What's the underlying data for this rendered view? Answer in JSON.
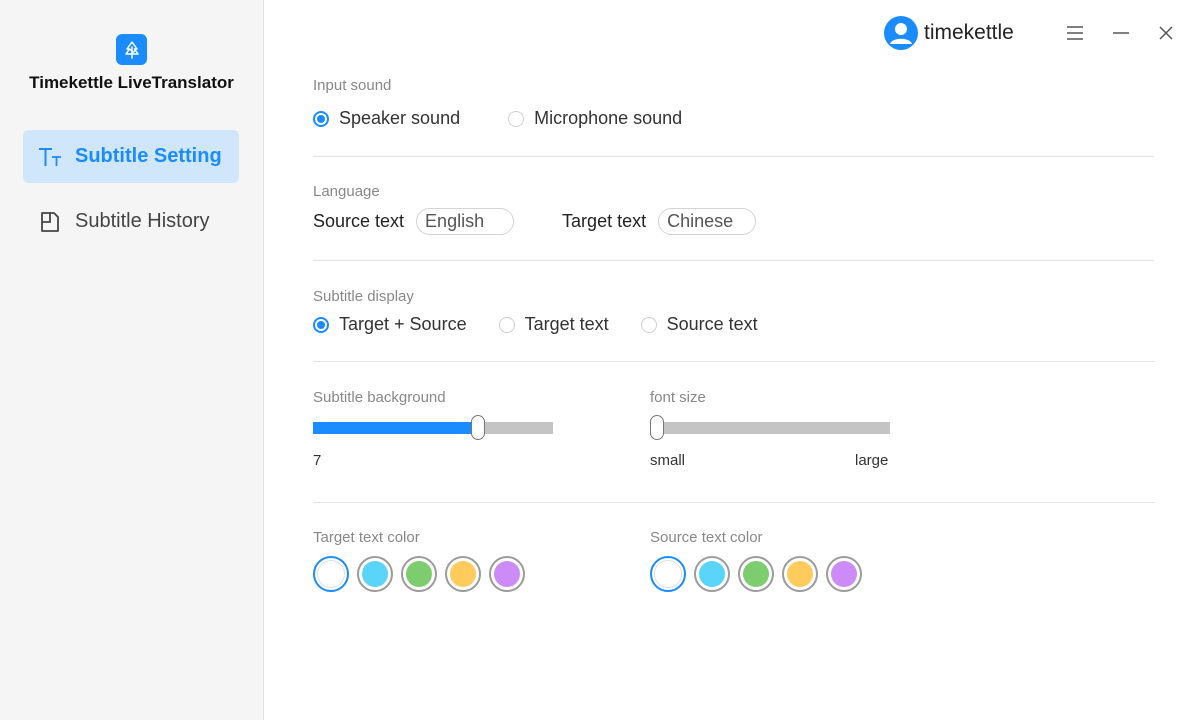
{
  "app": {
    "title": "Timekettle LiveTranslator"
  },
  "sidebar": {
    "items": [
      {
        "label": "Subtitle Setting",
        "icon": "text-size-icon",
        "active": true
      },
      {
        "label": "Subtitle History",
        "icon": "history-doc-icon",
        "active": false
      }
    ]
  },
  "header": {
    "user_name": "timekettle"
  },
  "input_sound": {
    "label": "Input sound",
    "options": [
      "Speaker sound",
      "Microphone sound"
    ],
    "selected": "Speaker sound"
  },
  "language": {
    "label": "Language",
    "source_label": "Source text",
    "source_value": "English",
    "target_label": "Target text",
    "target_value": "Chinese"
  },
  "subtitle_display": {
    "label": "Subtitle display",
    "options": [
      "Target + Source",
      "Target text",
      "Source text"
    ],
    "selected": "Target + Source"
  },
  "subtitle_background": {
    "label": "Subtitle background",
    "value": "7",
    "level_fraction": 0.7
  },
  "font_size": {
    "label": "font size",
    "min_label": "small",
    "max_label": "large",
    "level_fraction": 0.0
  },
  "target_text_color": {
    "label": "Target text color",
    "colors": [
      "#ffffff",
      "#5ad4f9",
      "#7dcd6f",
      "#ffcb5c",
      "#cc8bf7"
    ],
    "selected_index": 0
  },
  "source_text_color": {
    "label": "Source text color",
    "colors": [
      "#ffffff",
      "#5ad4f9",
      "#7dcd6f",
      "#ffcb5c",
      "#cc8bf7"
    ],
    "selected_index": 0
  },
  "colors": {
    "accent": "#1a8cff",
    "active_nav_bg": "#cfe6fb"
  }
}
